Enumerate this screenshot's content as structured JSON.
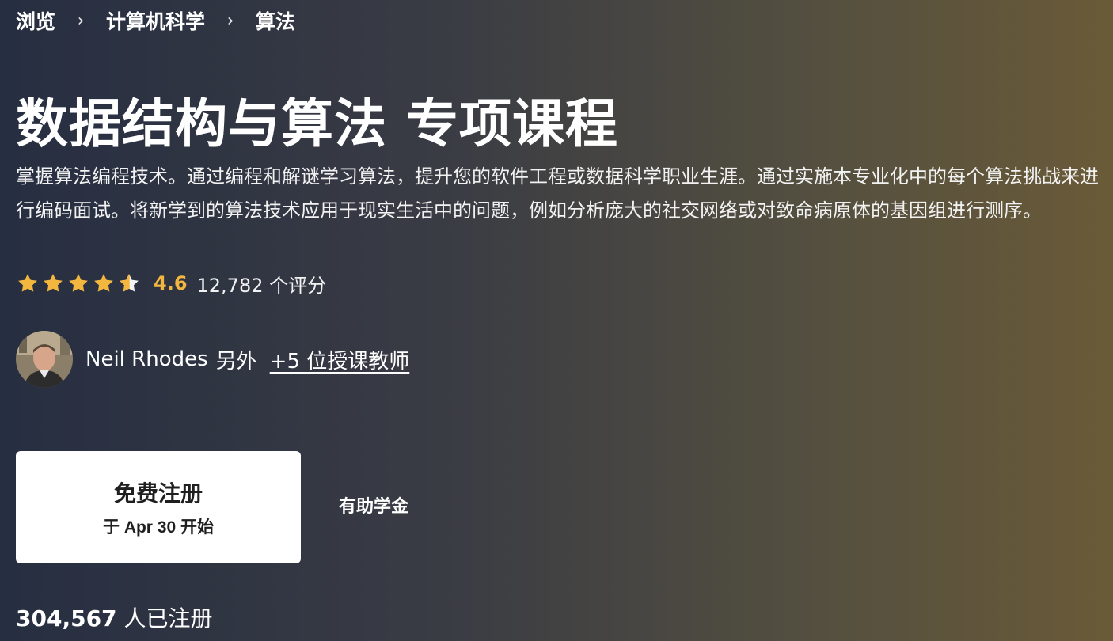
{
  "breadcrumb": {
    "items": [
      "浏览",
      "计算机科学",
      "算法"
    ],
    "separator": "›"
  },
  "course": {
    "title": "数据结构与算法 专项课程",
    "description": "掌握算法编程技术。通过编程和解谜学习算法，提升您的软件工程或数据科学职业生涯。通过实施本专业化中的每个算法挑战来进行编码面试。将新学到的算法技术应用于现实生活中的问题，例如分析庞大的社交网络或对致命病原体的基因组进行测序。"
  },
  "rating": {
    "value": "4.6",
    "stars": 4.6,
    "count_label": "12,782 个评分",
    "star_color": "#f3b73f"
  },
  "instructor": {
    "name": "Neil Rhodes",
    "extra": "另外",
    "more_link": "+5 位授课教师"
  },
  "enroll": {
    "main_label": "免费注册",
    "sub_label": "于 Apr 30 开始"
  },
  "financial_aid": "有助学金",
  "enrolled": {
    "count": "304,567",
    "label": "人已注册"
  }
}
